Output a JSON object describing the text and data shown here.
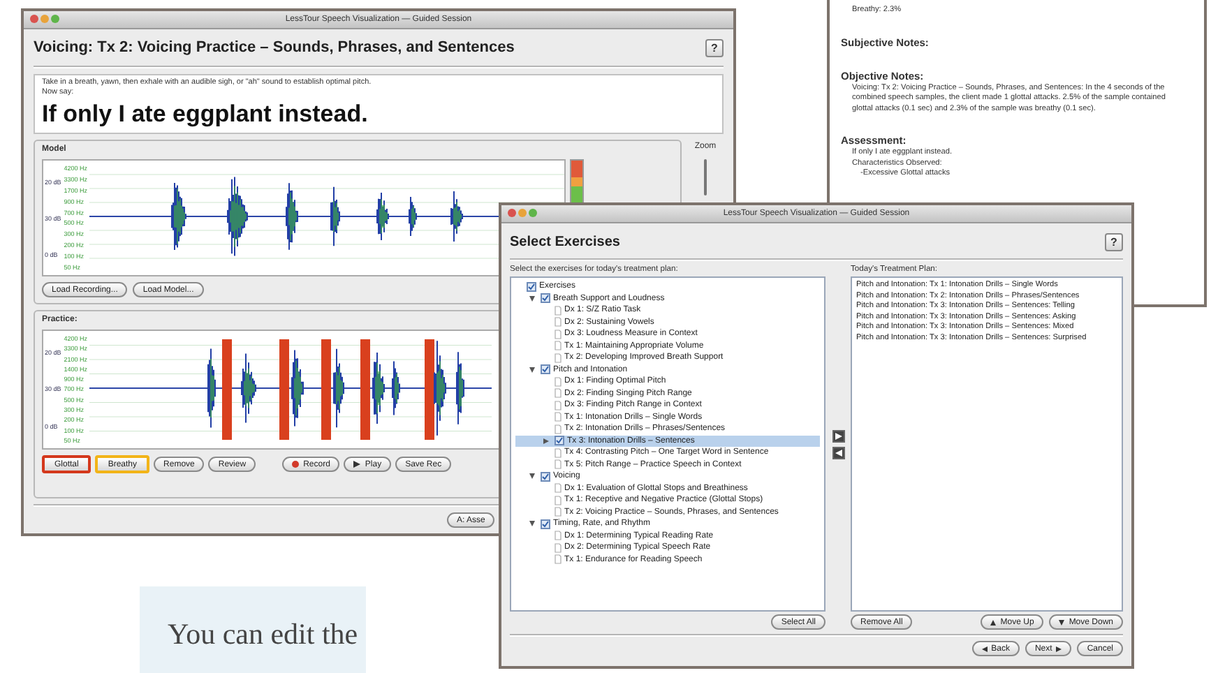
{
  "report_window": {
    "lines": [
      {
        "kind": "value",
        "text": "Breathy: 2.3%"
      },
      {
        "kind": "heading",
        "text": "Subjective Notes:"
      },
      {
        "kind": "heading",
        "text": "Objective Notes:"
      },
      {
        "kind": "paragraph",
        "text": "Voicing: Tx 2: Voicing Practice – Sounds, Phrases, and Sentences: In the 4 seconds of the combined speech samples, the client made 1 glottal attacks. 2.5% of the sample contained glottal attacks (0.1 sec) and 2.3% of the sample was breathy (0.1 sec)."
      },
      {
        "kind": "heading",
        "text": "Assessment:"
      },
      {
        "kind": "value",
        "text": "If only I ate eggplant instead."
      },
      {
        "kind": "value",
        "text": "Characteristics Observed:"
      },
      {
        "kind": "item",
        "text": "-Excessive Glottal attacks"
      }
    ]
  },
  "main_window": {
    "title": "LessTour Speech Visualization — Guided Session",
    "heading": "Voicing: Tx 2: Voicing Practice – Sounds, Phrases, and Sentences",
    "help": "?",
    "instruction": "Take in a breath, yawn, then exhale with an audible sigh, or \"ah\" sound to establish optimal pitch.",
    "prompt": "Now say:",
    "sentence": "If only I ate eggplant instead.",
    "model": {
      "label": "Model",
      "db_labels": [
        "20 dB",
        "30 dB",
        "0 dB"
      ],
      "hz_labels": [
        "4200 Hz",
        "3300 Hz",
        "1700 Hz",
        "900 Hz",
        "700 Hz",
        "500 Hz",
        "300 Hz",
        "200 Hz",
        "100 Hz",
        "50 Hz"
      ],
      "buttons": [
        "Load Recording...",
        "Load Model..."
      ]
    },
    "zoom_label": "Zoom",
    "practice": {
      "label": "Practice:",
      "db_labels": [
        "20 dB",
        "30 dB",
        "0 dB"
      ],
      "hz_labels": [
        "4200 Hz",
        "3300 Hz",
        "2100 Hz",
        "1400 Hz",
        "900 Hz",
        "700 Hz",
        "500 Hz",
        "300 Hz",
        "200 Hz",
        "100 Hz",
        "50 Hz"
      ],
      "buttons": [
        {
          "label": "Glottal",
          "kind": "marker",
          "color": "#d4381c"
        },
        {
          "label": "Breathy",
          "kind": "marker",
          "color": "#f2b418"
        },
        {
          "label": "Remove",
          "kind": "plain"
        },
        {
          "label": "Review",
          "kind": "plain"
        },
        {
          "label": "Record",
          "kind": "record"
        },
        {
          "label": "Play",
          "kind": "play"
        },
        {
          "label": "Save Rec",
          "kind": "plain"
        }
      ]
    },
    "footer_button": "A: Asse"
  },
  "select_window": {
    "title": "LessTour Speech Visualization — Guided Session",
    "heading": "Select Exercises",
    "help": "?",
    "instruction": "Select the exercises for today's treatment plan:",
    "tree": [
      {
        "label": "Exercises",
        "selected": false,
        "children": [
          {
            "label": "Breath Support and Loudness",
            "selected": false,
            "expanded": true,
            "children": [
              {
                "label": "Dx 1: S/Z Ratio Task",
                "selected": false
              },
              {
                "label": "Dx 2: Sustaining Vowels",
                "selected": false
              },
              {
                "label": "Dx 3: Loudness Measure in Context",
                "selected": false
              },
              {
                "label": "Tx 1: Maintaining Appropriate Volume",
                "selected": false
              },
              {
                "label": "Tx 2: Developing Improved Breath Support",
                "selected": false
              }
            ]
          },
          {
            "label": "Pitch and Intonation",
            "selected": false,
            "expanded": true,
            "children": [
              {
                "label": "Dx 1: Finding Optimal Pitch",
                "selected": false
              },
              {
                "label": "Dx 2: Finding Singing Pitch Range",
                "selected": false
              },
              {
                "label": "Dx 3: Finding Pitch Range in Context",
                "selected": false
              },
              {
                "label": "Tx 1: Intonation Drills – Single Words",
                "selected": false
              },
              {
                "label": "Tx 2: Intonation Drills – Phrases/Sentences",
                "selected": false
              },
              {
                "label": "Tx 3: Intonation Drills – Sentences",
                "selected": true,
                "expanded": false
              },
              {
                "label": "Tx 4: Contrasting Pitch – One Target Word in Sentence",
                "selected": false
              },
              {
                "label": "Tx 5: Pitch Range – Practice Speech in Context",
                "selected": false
              }
            ]
          },
          {
            "label": "Voicing",
            "selected": false,
            "expanded": true,
            "children": [
              {
                "label": "Dx 1: Evaluation of Glottal Stops and Breathiness",
                "selected": false
              },
              {
                "label": "Tx 1: Receptive and Negative Practice (Glottal Stops)",
                "selected": false
              },
              {
                "label": "Tx 2: Voicing Practice – Sounds, Phrases, and Sentences",
                "selected": false
              }
            ]
          },
          {
            "label": "Timing, Rate, and Rhythm",
            "selected": false,
            "expanded": true,
            "children": [
              {
                "label": "Dx 1: Determining Typical Reading Rate",
                "selected": false
              },
              {
                "label": "Dx 2: Determining Typical Speech Rate",
                "selected": false
              },
              {
                "label": "Tx 1: Endurance for Reading Speech",
                "selected": false
              }
            ]
          }
        ]
      }
    ],
    "select_all": "Select All",
    "plan_label": "Today's Treatment Plan:",
    "plan": [
      "Pitch and Intonation: Tx 1: Intonation Drills – Single Words",
      "Pitch and Intonation: Tx 2: Intonation Drills – Phrases/Sentences",
      "Pitch and Intonation: Tx 3: Intonation Drills – Sentences: Telling",
      "Pitch and Intonation: Tx 3: Intonation Drills – Sentences: Asking",
      "Pitch and Intonation: Tx 3: Intonation Drills – Sentences: Mixed",
      "Pitch and Intonation: Tx 3: Intonation Drills – Sentences: Surprised"
    ],
    "remove_all": "Remove All",
    "move_up": "Move Up",
    "move_down": "Move Down",
    "back": "Back",
    "next": "Next",
    "cancel": "Cancel"
  },
  "caption": "You can edit the"
}
